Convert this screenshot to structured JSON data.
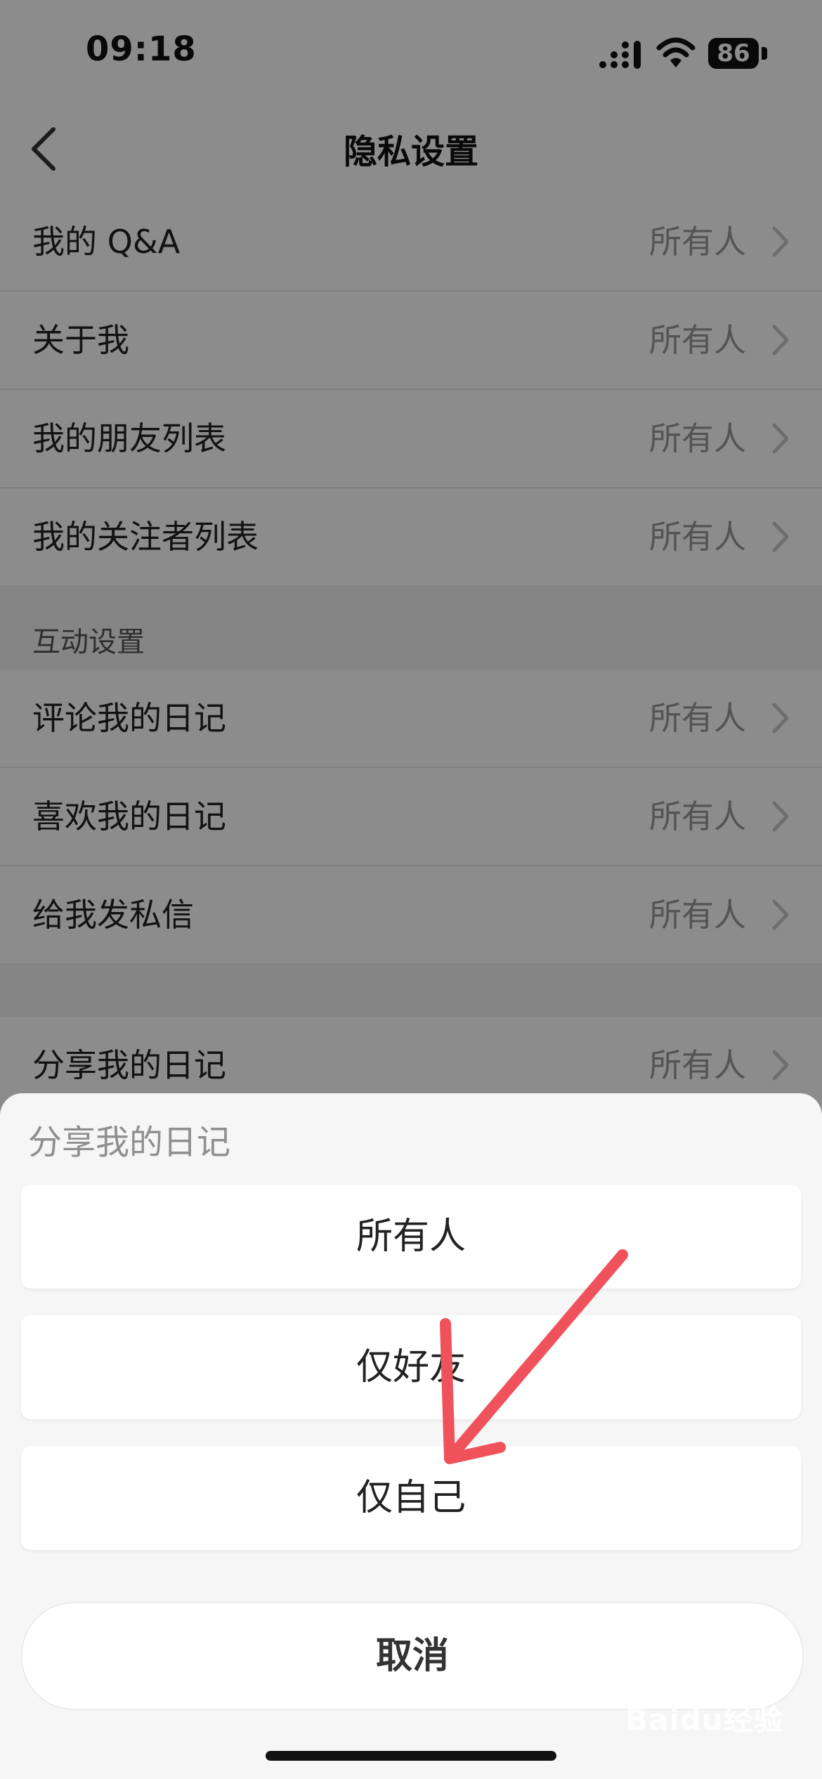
{
  "status_bar": {
    "time": "09:18",
    "battery": "86"
  },
  "nav": {
    "title": "隐私设置"
  },
  "rows_group1": [
    {
      "label": "我的 Q&A",
      "value": "所有人"
    },
    {
      "label": "关于我",
      "value": "所有人"
    },
    {
      "label": "我的朋友列表",
      "value": "所有人"
    },
    {
      "label": "我的关注者列表",
      "value": "所有人"
    }
  ],
  "section_interaction": "互动设置",
  "rows_group2": [
    {
      "label": "评论我的日记",
      "value": "所有人"
    },
    {
      "label": "喜欢我的日记",
      "value": "所有人"
    },
    {
      "label": "给我发私信",
      "value": "所有人"
    }
  ],
  "rows_group3": [
    {
      "label": "分享我的日记",
      "value": "所有人"
    }
  ],
  "sheet": {
    "title": "分享我的日记",
    "options": [
      "所有人",
      "仅好友",
      "仅自己"
    ],
    "cancel": "取消"
  },
  "watermark": {
    "text": "Baidu经验"
  },
  "colors": {
    "arrow": "#f0525b",
    "overlay": "rgba(0,0,0,0.45)"
  }
}
